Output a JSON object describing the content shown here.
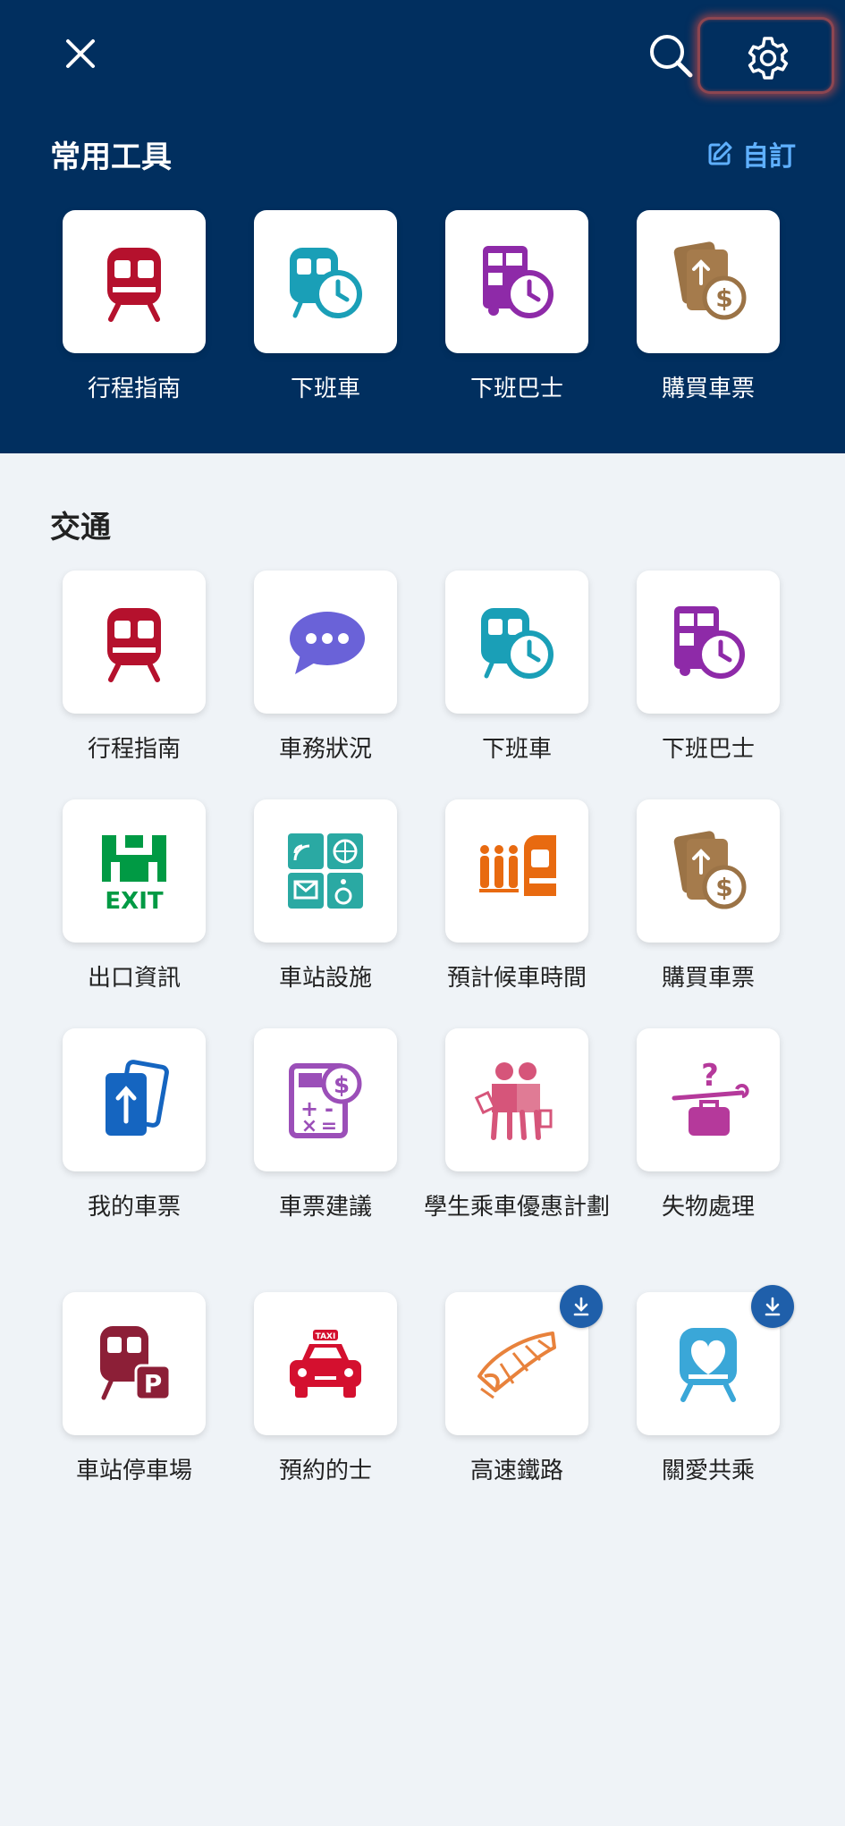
{
  "header": {
    "section_title": "常用工具",
    "edit_label": "自訂",
    "tools": [
      {
        "label": "行程指南",
        "icon": "train-icon"
      },
      {
        "label": "下班車",
        "icon": "next-train-icon"
      },
      {
        "label": "下班巴士",
        "icon": "next-bus-icon"
      },
      {
        "label": "購買車票",
        "icon": "buy-ticket-icon"
      }
    ]
  },
  "transport": {
    "section_title": "交通",
    "items": [
      {
        "label": "行程指南",
        "icon": "train-icon"
      },
      {
        "label": "車務狀況",
        "icon": "chat-bubble-icon"
      },
      {
        "label": "下班車",
        "icon": "next-train-icon"
      },
      {
        "label": "下班巴士",
        "icon": "next-bus-icon"
      },
      {
        "label": "出口資訊",
        "icon": "exit-icon"
      },
      {
        "label": "車站設施",
        "icon": "station-facilities-icon"
      },
      {
        "label": "預計候車時間",
        "icon": "waiting-time-icon"
      },
      {
        "label": "購買車票",
        "icon": "buy-ticket-icon"
      },
      {
        "label": "我的車票",
        "icon": "my-ticket-icon"
      },
      {
        "label": "車票建議",
        "icon": "fare-calculator-icon"
      },
      {
        "label": "學生乘車優惠計劃",
        "icon": "student-icon"
      },
      {
        "label": "失物處理",
        "icon": "lost-property-icon"
      },
      {
        "label": "車站停車場",
        "icon": "parking-icon"
      },
      {
        "label": "預約的士",
        "icon": "taxi-icon"
      },
      {
        "label": "高速鐵路",
        "icon": "high-speed-rail-icon",
        "download": true
      },
      {
        "label": "關愛共乘",
        "icon": "caring-ride-icon",
        "download": true
      }
    ]
  },
  "colors": {
    "header_bg": "#012f5f",
    "accent_blue": "#5fb0ff",
    "mtr_red": "#b5112d",
    "teal": "#1a9fb7",
    "purple": "#8e2aa8",
    "brown": "#9b7346"
  }
}
